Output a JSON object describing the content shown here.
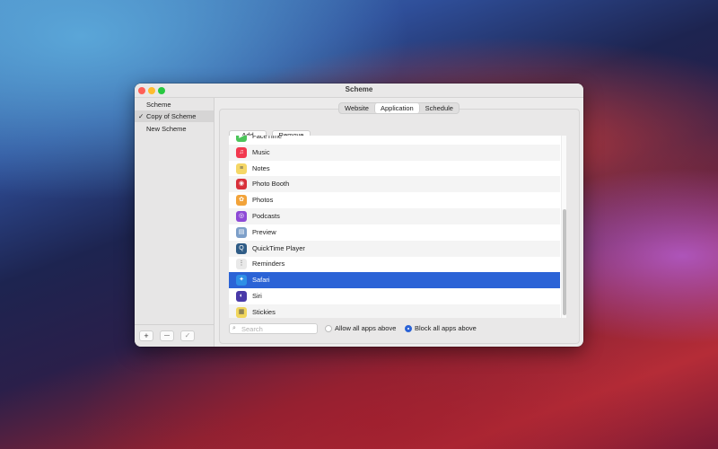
{
  "window": {
    "title": "Scheme"
  },
  "sidebar": {
    "items": [
      {
        "label": "Scheme",
        "selected": false,
        "checked": false
      },
      {
        "label": "Copy of Scheme",
        "selected": true,
        "checked": true
      },
      {
        "label": "New Scheme",
        "selected": false,
        "checked": false
      }
    ],
    "check_glyph": "✓",
    "add_glyph": "+",
    "remove_glyph": "—",
    "apply_glyph": "✓"
  },
  "tabs": [
    {
      "label": "Website",
      "active": false
    },
    {
      "label": "Application",
      "active": true
    },
    {
      "label": "Schedule",
      "active": false
    }
  ],
  "actions": {
    "add_label": "Add",
    "remove_label": "Remove"
  },
  "apps": [
    {
      "name": "FaceTime",
      "icon": "facetime-icon",
      "color": "#4cc55a",
      "glyph": "▶"
    },
    {
      "name": "Music",
      "icon": "music-icon",
      "color": "#f2394f",
      "glyph": "♫"
    },
    {
      "name": "Notes",
      "icon": "notes-icon",
      "color": "#f5d766",
      "glyph": "≡"
    },
    {
      "name": "Photo Booth",
      "icon": "photo-booth-icon",
      "color": "#d8303a",
      "glyph": "◉"
    },
    {
      "name": "Photos",
      "icon": "photos-icon",
      "color": "#f2a33a",
      "glyph": "✿"
    },
    {
      "name": "Podcasts",
      "icon": "podcasts-icon",
      "color": "#8e4ad6",
      "glyph": "◎"
    },
    {
      "name": "Preview",
      "icon": "preview-icon",
      "color": "#7d9fc9",
      "glyph": "▤"
    },
    {
      "name": "QuickTime Player",
      "icon": "quicktime-icon",
      "color": "#2f5c86",
      "glyph": "Q"
    },
    {
      "name": "Reminders",
      "icon": "reminders-icon",
      "color": "#e9e9e9",
      "glyph": "⋮"
    },
    {
      "name": "Safari",
      "icon": "safari-icon",
      "color": "#2f8fe6",
      "glyph": "✦",
      "selected": true
    },
    {
      "name": "Siri",
      "icon": "siri-icon",
      "color": "#4a3aa8",
      "glyph": "◐"
    },
    {
      "name": "Stickies",
      "icon": "stickies-icon",
      "color": "#f1d65c",
      "glyph": "▦"
    }
  ],
  "search": {
    "placeholder": "Search",
    "value": "",
    "icon_glyph": "⌕"
  },
  "mode": {
    "allow_label": "Allow all apps above",
    "block_label": "Block all apps above",
    "selected": "block"
  },
  "colors": {
    "selection": "#2b63d6",
    "close": "#fe5f57",
    "minimize": "#febc2e",
    "maximize": "#28c840"
  }
}
